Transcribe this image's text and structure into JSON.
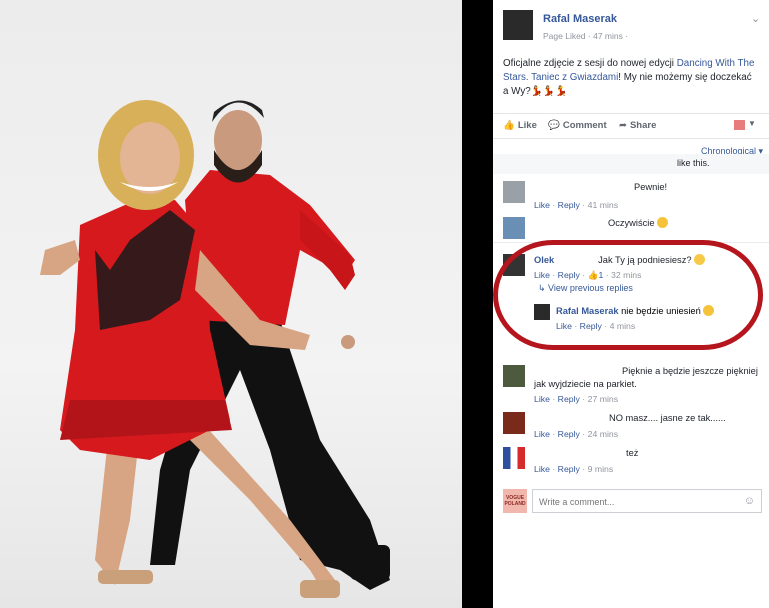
{
  "post": {
    "author": "Rafal Maserak",
    "meta": "Page Liked · 47 mins ·",
    "text_before": "Oficjalne zdjęcie z sesji do nowej edycji ",
    "text_link": "Dancing With The Stars. Taniec z Gwiazdami",
    "text_after": "! My nie możemy się doczekać a Wy?💃💃💃"
  },
  "actions": {
    "like": "Like",
    "comment": "Comment",
    "share": "Share"
  },
  "sort": "Chronological ▾",
  "likes_text": "like this.",
  "comments": [
    {
      "name": "",
      "text": "Pewnie!",
      "like": "Like",
      "reply": "Reply",
      "time": "41 mins"
    },
    {
      "name": "",
      "text": "Oczywiście",
      "like": "",
      "reply": "",
      "time": ""
    },
    {
      "name": "Olek",
      "text": "Jak Ty ją podniesiesz?",
      "like": "Like",
      "reply": "Reply",
      "likes": "1",
      "time": "32 mins"
    },
    {
      "name": "",
      "text": "Pięknie a będzie jeszcze piękniej jak wyjdziecie na parkiet.",
      "like": "Like",
      "reply": "Reply",
      "time": "27 mins"
    },
    {
      "name": "",
      "text": "NO masz.... jasne ze tak......",
      "like": "Like",
      "reply": "Reply",
      "time": "24 mins"
    },
    {
      "name": "",
      "text": "też",
      "like": "Like",
      "reply": "Reply",
      "time": "9 mins"
    }
  ],
  "view_previous": "View previous replies",
  "reply": {
    "name": "Rafal Maserak",
    "text": "nie będzie uniesień",
    "like": "Like",
    "reply": "Reply",
    "time": "4 mins"
  },
  "composer": {
    "placeholder": "Write a comment...",
    "brand": "VOGUE POLAND"
  },
  "colors": {
    "link": "#365899",
    "annotation": "#b5161d",
    "dress": "#d6191d"
  }
}
